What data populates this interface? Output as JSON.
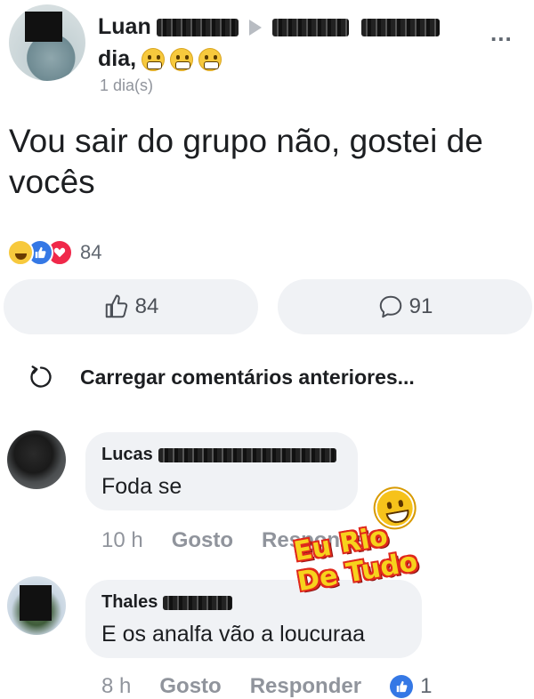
{
  "post": {
    "author_first_name": "Luan",
    "author_line2_word": "dia,",
    "time": "1 dia(s)",
    "more_glyph": "...",
    "text": "Vou sair do grupo não, gostei de vocês",
    "reaction_count": "84"
  },
  "actions": {
    "like_count": "84",
    "comment_count": "91"
  },
  "load_earlier": {
    "label": "Carregar comentários anteriores..."
  },
  "comments": [
    {
      "author_first_name": "Lucas",
      "text": "Foda se",
      "time": "10 h",
      "like_label": "Gosto",
      "reply_label": "Responder"
    },
    {
      "author_first_name": "Thales",
      "text": "E os analfa vão a loucuraa",
      "time": "8 h",
      "like_label": "Gosto",
      "reply_label": "Responder",
      "like_count": "1"
    }
  ],
  "watermark": {
    "line1": "Eu Rio",
    "line2": "De Tudo"
  },
  "colors": {
    "accent_blue": "#3578e5",
    "love_red": "#f0284a",
    "haha_yellow": "#f7c93d",
    "bubble_gray": "#f0f2f5",
    "meta_gray": "#90949c"
  },
  "icons": [
    "more-icon",
    "grin-emoji-icon",
    "haha-reaction-icon",
    "like-reaction-icon",
    "love-reaction-icon",
    "thumbs-up-icon",
    "comment-bubble-icon",
    "reload-icon",
    "like-badge-icon"
  ]
}
